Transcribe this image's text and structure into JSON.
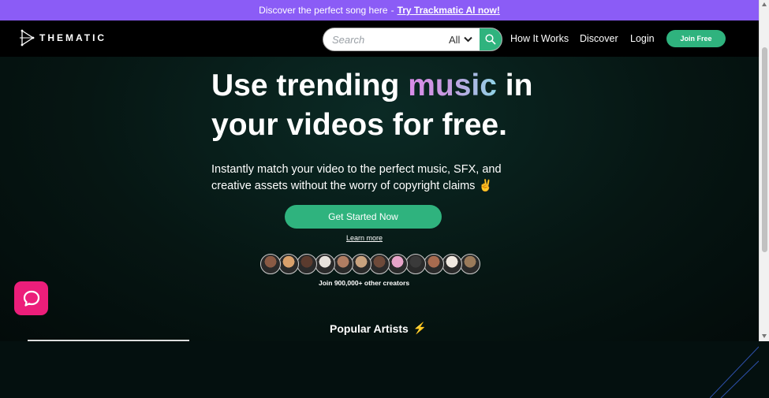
{
  "banner": {
    "text": "Discover the perfect song here",
    "link": "Try Trackmatic AI now!"
  },
  "nav": {
    "logo_text": "THEMATIC",
    "search": {
      "placeholder": "Search",
      "filter": "All"
    },
    "links": [
      "How It Works",
      "Discover",
      "Login"
    ],
    "join_label": "Join Free"
  },
  "hero": {
    "title_part1": "Use trending",
    "title_highlight": "music",
    "title_part2": "in",
    "title_line2": "your videos for free.",
    "subtitle": "Instantly match your video to the perfect music, SFX, and creative assets without the worry of copyright claims ✌️",
    "cta": "Get Started Now",
    "learn_more": "Learn more",
    "join_creators": "Join 900,000+ other creators",
    "avatar_colors": [
      "#8a5a44",
      "#d9a06b",
      "#5b3b2e",
      "#e8e2dc",
      "#b07d62",
      "#c9a27e",
      "#6e4a3a",
      "#e7a3c8",
      "#3a3a3a",
      "#a86b4f",
      "#f0e8e0",
      "#9a7a5a"
    ]
  },
  "popular": {
    "title": "Popular Artists",
    "emoji": "⚡"
  },
  "colors": {
    "banner": "#8b5cf6",
    "accent": "#2fb37e",
    "chat": "#ec1e7a"
  }
}
